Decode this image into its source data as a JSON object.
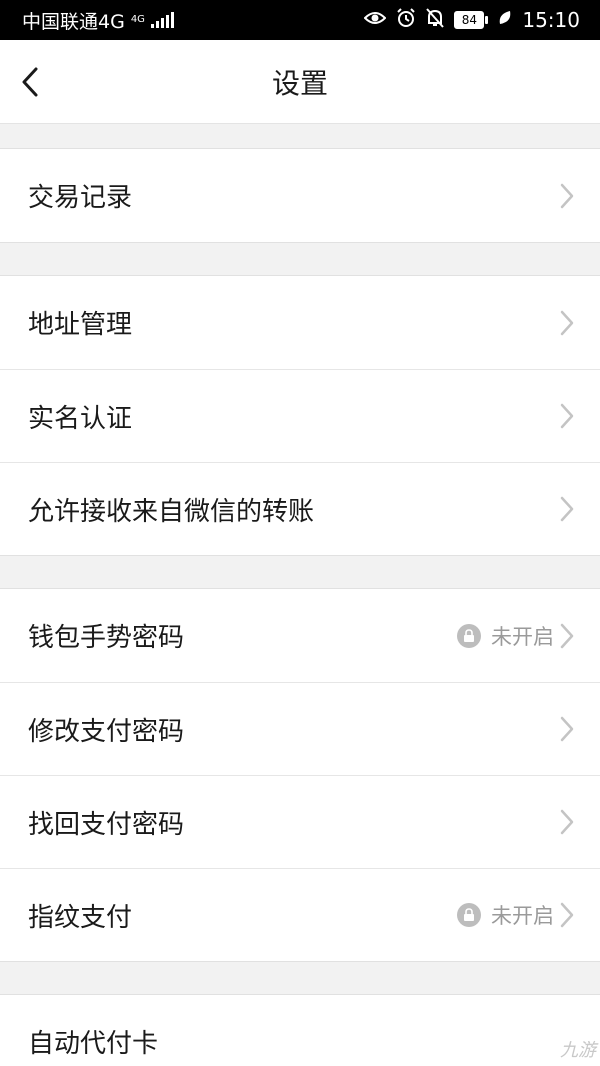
{
  "status_bar": {
    "carrier": "中国联通4G",
    "network_small": "4G",
    "battery": "84",
    "time": "15:10"
  },
  "header": {
    "title": "设置"
  },
  "groups": [
    {
      "items": [
        {
          "label": "交易记录"
        }
      ]
    },
    {
      "items": [
        {
          "label": "地址管理"
        },
        {
          "label": "实名认证"
        },
        {
          "label": "允许接收来自微信的转账"
        }
      ]
    },
    {
      "items": [
        {
          "label": "钱包手势密码",
          "status": "未开启"
        },
        {
          "label": "修改支付密码"
        },
        {
          "label": "找回支付密码"
        },
        {
          "label": "指纹支付",
          "status": "未开启"
        }
      ]
    },
    {
      "items": [
        {
          "label": "自动代付卡"
        }
      ]
    }
  ],
  "watermark": "九游",
  "icons": {
    "back": "chevron-left-icon",
    "row_arrow": "chevron-right-icon",
    "lock": "lock-icon"
  }
}
